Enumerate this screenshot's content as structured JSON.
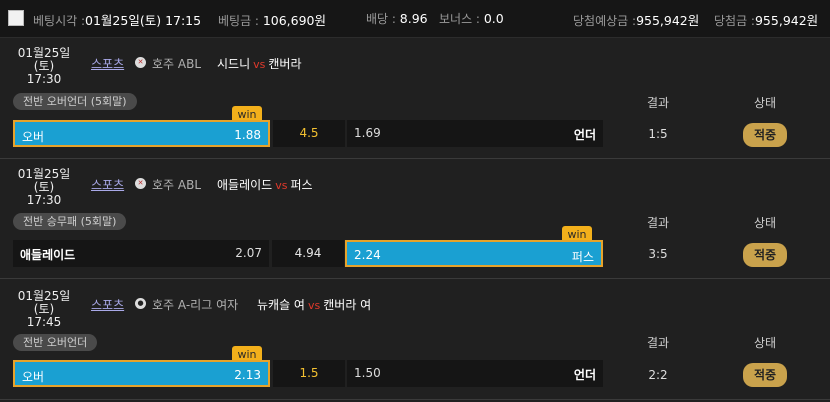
{
  "header": {
    "bet_time_label": "베팅시각 :",
    "bet_time_value": "01월25일(토) 17:15",
    "bet_amount_label": "베팅금 :",
    "bet_amount_value": "106,690원",
    "odds_label": "배당 :",
    "odds_value": "8.96",
    "bonus_label": "보너스 :",
    "bonus_value": "0.0",
    "expected_win_label": "당첨예상금 :",
    "expected_win_value": "955,942원",
    "win_amount_label": "당첨금 :",
    "win_amount_value": "955,942원"
  },
  "columns": {
    "result": "결과",
    "status": "상태"
  },
  "win_badge": "win",
  "bets": [
    {
      "date": "01월25일(토)",
      "time": "17:30",
      "sport": "스포츠",
      "league": "호주 ABL",
      "home": "시드니",
      "vs": "vs",
      "away": "캔버라",
      "market": "전반 오버언더 (5회말)",
      "left_label": "오버",
      "left_odds": "1.88",
      "middle": "4.5",
      "right_odds": "1.69",
      "right_label": "언더",
      "result": "1:5",
      "status": "적중"
    },
    {
      "date": "01월25일(토)",
      "time": "17:30",
      "sport": "스포츠",
      "league": "호주 ABL",
      "home": "애들레이드",
      "vs": "vs",
      "away": "퍼스",
      "market": "전반 승무패 (5회말)",
      "left_label": "애들레이드",
      "left_odds": "2.07",
      "middle": "4.94",
      "right_odds": "2.24",
      "right_label": "퍼스",
      "result": "3:5",
      "status": "적중"
    },
    {
      "date": "01월25일(토)",
      "time": "17:45",
      "sport": "스포츠",
      "league": "호주 A-리그 여자",
      "home": "뉴캐슬 여",
      "vs": "vs",
      "away": "캔버라 여",
      "market": "전반 오버언더",
      "left_label": "오버",
      "left_odds": "2.13",
      "middle": "1.5",
      "right_odds": "1.50",
      "right_label": "언더",
      "result": "2:2",
      "status": "적중"
    }
  ]
}
